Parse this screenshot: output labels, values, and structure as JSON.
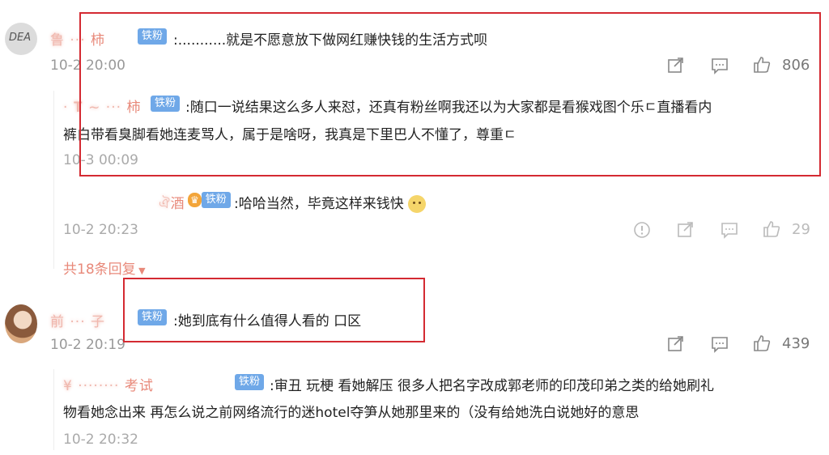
{
  "comments": [
    {
      "name_fragment": "柿",
      "badge": "铁粉",
      "text": ":...........就是不愿意放下做网红赚快钱的生活方式呗",
      "time": "10-2 20:00",
      "likes": "806"
    },
    {
      "name_fragment": "柿",
      "badge": "铁粉",
      "text_line1": ":随口一说结果这么多人来怼，还真有粉丝啊我还以为大家都是看猴戏图个乐ㄷ直播看内",
      "text_line2": "裤白带看臭脚看她连麦骂人，属于是啥呀，我真是下里巴人不懂了，尊重ㄷ",
      "time": "10-3 00:09"
    },
    {
      "name_fragment": "酒",
      "badge": "铁粉",
      "text": ":哈哈当然，毕竟这样来钱快",
      "time": "10-2 20:23",
      "likes": "29"
    },
    {
      "more_replies": "共18条回复",
      "badge": "铁粉",
      "text": ":她到底有什么值得人看的 口区",
      "time": "10-2 20:19",
      "likes": "439"
    },
    {
      "name_fragment": "考试",
      "badge": "铁粉",
      "text_line1": ":审丑 玩梗 看她解压 很多人把名字改成郭老师的印茂印弟之类的给她刷礼",
      "text_line2": "物看她念出来 再怎么说之前网络流行的迷hotel夺笋从她那里来的（没有给她洗白说她好的意思",
      "time": "10-2 20:32"
    }
  ],
  "colors": {
    "highlight_box": "#d42a32",
    "badge": "#6fa8e8",
    "name": "#e8897a"
  }
}
